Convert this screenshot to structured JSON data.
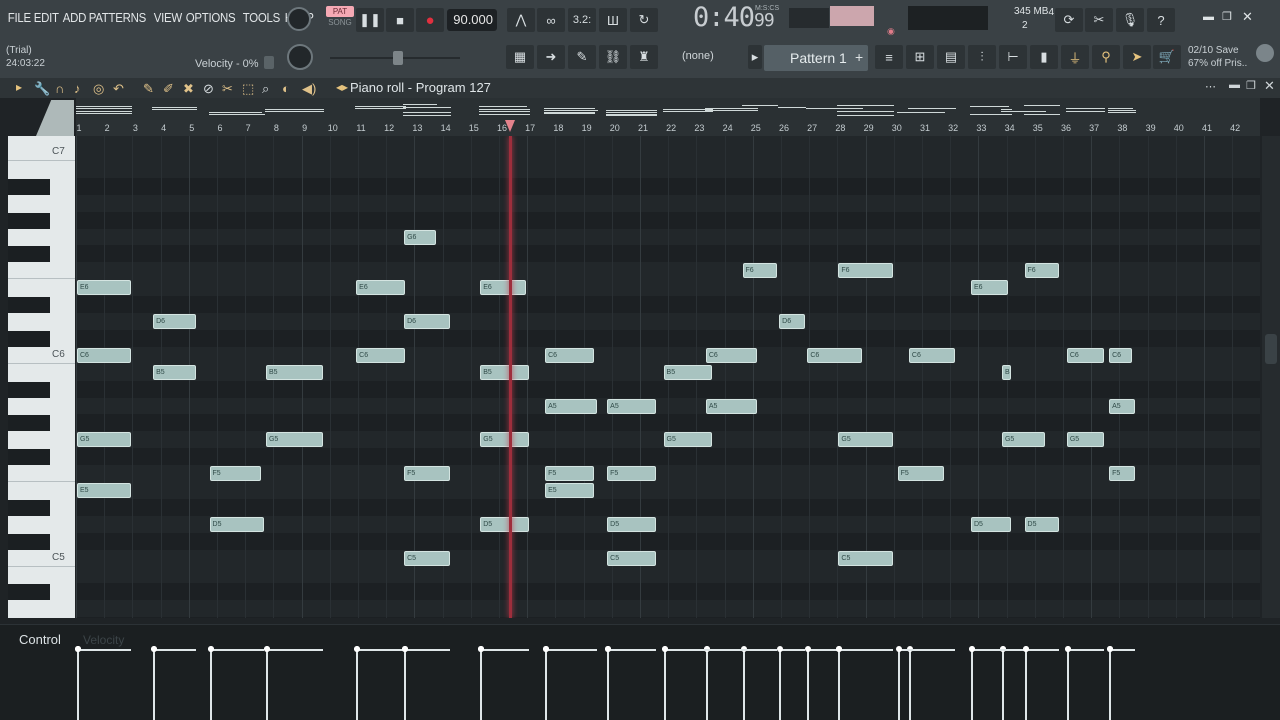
{
  "menu": [
    "FILE",
    "EDIT",
    "ADD",
    "PATTERNS",
    "VIEW",
    "OPTIONS",
    "TOOLS",
    "HELP"
  ],
  "status": {
    "trial": "(Trial)",
    "clock": "24:03:22",
    "hint": "Velocity - 0%"
  },
  "transport": {
    "pat_label": "PAT",
    "song_label": "SONG",
    "tempo": "90.000",
    "time_main": "0:40",
    "time_sub": "99",
    "time_mode": "M:S:CS",
    "snap_label": "3.2:"
  },
  "cpu": {
    "cores": "4",
    "memory": "345 MB",
    "polyphony": "2"
  },
  "promo": {
    "line1": "02/10  Save",
    "line2": "67% off Pris.."
  },
  "channel_select": "(none)",
  "pattern_label": "Pattern 1",
  "piano_roll": {
    "title": "Piano roll - Program 127",
    "octave_labels": [
      "C7",
      "C6",
      "C5"
    ],
    "ruler": [
      "1",
      "2",
      "3",
      "4",
      "5",
      "6",
      "7",
      "8",
      "9",
      "10",
      "11",
      "12",
      "13",
      "14",
      "15",
      "16",
      "17",
      "18",
      "19",
      "20",
      "21",
      "22",
      "23",
      "24",
      "25",
      "26",
      "27",
      "28",
      "29",
      "30",
      "31",
      "32",
      "33",
      "34",
      "35",
      "36",
      "37",
      "38",
      "39",
      "40",
      "41",
      "42"
    ],
    "notes": [
      {
        "pitch": "G6",
        "start": 12.6,
        "len": 1.2
      },
      {
        "pitch": "E6",
        "start": 1,
        "len": 2
      },
      {
        "pitch": "E6",
        "start": 10.9,
        "len": 1.8
      },
      {
        "pitch": "E6",
        "start": 15.3,
        "len": 1.7
      },
      {
        "pitch": "E6",
        "start": 32.7,
        "len": 1.4
      },
      {
        "pitch": "F6",
        "start": 24.6,
        "len": 1.3
      },
      {
        "pitch": "F6",
        "start": 28.0,
        "len": 2
      },
      {
        "pitch": "F6",
        "start": 34.6,
        "len": 1.3
      },
      {
        "pitch": "D6",
        "start": 3.7,
        "len": 1.6
      },
      {
        "pitch": "D6",
        "start": 12.6,
        "len": 1.7
      },
      {
        "pitch": "D6",
        "start": 25.9,
        "len": 1.0
      },
      {
        "pitch": "C6",
        "start": 1,
        "len": 2
      },
      {
        "pitch": "C6",
        "start": 10.9,
        "len": 1.8
      },
      {
        "pitch": "C6",
        "start": 17.6,
        "len": 1.8
      },
      {
        "pitch": "C6",
        "start": 23.3,
        "len": 1.9
      },
      {
        "pitch": "C6",
        "start": 26.9,
        "len": 2
      },
      {
        "pitch": "C6",
        "start": 30.5,
        "len": 1.7
      },
      {
        "pitch": "C6",
        "start": 36.1,
        "len": 1.4
      },
      {
        "pitch": "C6",
        "start": 37.6,
        "len": 0.9
      },
      {
        "pitch": "B5",
        "start": 3.7,
        "len": 1.6
      },
      {
        "pitch": "B5",
        "start": 7.7,
        "len": 2.1
      },
      {
        "pitch": "B5",
        "start": 15.3,
        "len": 1.8
      },
      {
        "pitch": "B5",
        "start": 21.8,
        "len": 1.8
      },
      {
        "pitch": "B5",
        "start": 33.8,
        "len": 0.4
      },
      {
        "pitch": "A5",
        "start": 17.6,
        "len": 1.9
      },
      {
        "pitch": "A5",
        "start": 19.8,
        "len": 1.8
      },
      {
        "pitch": "A5",
        "start": 23.3,
        "len": 1.9
      },
      {
        "pitch": "A5",
        "start": 37.6,
        "len": 1.0
      },
      {
        "pitch": "G5",
        "start": 1,
        "len": 2
      },
      {
        "pitch": "G5",
        "start": 7.7,
        "len": 2.1
      },
      {
        "pitch": "G5",
        "start": 15.3,
        "len": 1.8
      },
      {
        "pitch": "G5",
        "start": 21.8,
        "len": 1.8
      },
      {
        "pitch": "G5",
        "start": 28.0,
        "len": 2
      },
      {
        "pitch": "G5",
        "start": 33.8,
        "len": 1.6
      },
      {
        "pitch": "G5",
        "start": 36.1,
        "len": 1.4
      },
      {
        "pitch": "F5",
        "start": 5.7,
        "len": 1.9
      },
      {
        "pitch": "F5",
        "start": 12.6,
        "len": 1.7
      },
      {
        "pitch": "F5",
        "start": 17.6,
        "len": 1.8
      },
      {
        "pitch": "F5",
        "start": 19.8,
        "len": 1.8
      },
      {
        "pitch": "F5",
        "start": 30.1,
        "len": 1.7
      },
      {
        "pitch": "F5",
        "start": 37.6,
        "len": 1.0
      },
      {
        "pitch": "E5",
        "start": 1,
        "len": 2
      },
      {
        "pitch": "E5",
        "start": 17.6,
        "len": 1.8
      },
      {
        "pitch": "D5",
        "start": 5.7,
        "len": 2.0
      },
      {
        "pitch": "D5",
        "start": 15.3,
        "len": 1.8
      },
      {
        "pitch": "D5",
        "start": 19.8,
        "len": 1.8
      },
      {
        "pitch": "D5",
        "start": 32.7,
        "len": 1.5
      },
      {
        "pitch": "D5",
        "start": 34.6,
        "len": 1.3
      },
      {
        "pitch": "C5",
        "start": 12.6,
        "len": 1.7
      },
      {
        "pitch": "C5",
        "start": 19.8,
        "len": 1.8
      },
      {
        "pitch": "C5",
        "start": 28.0,
        "len": 2
      }
    ]
  },
  "control_lane": {
    "label": "Control",
    "target": "Velocity"
  }
}
